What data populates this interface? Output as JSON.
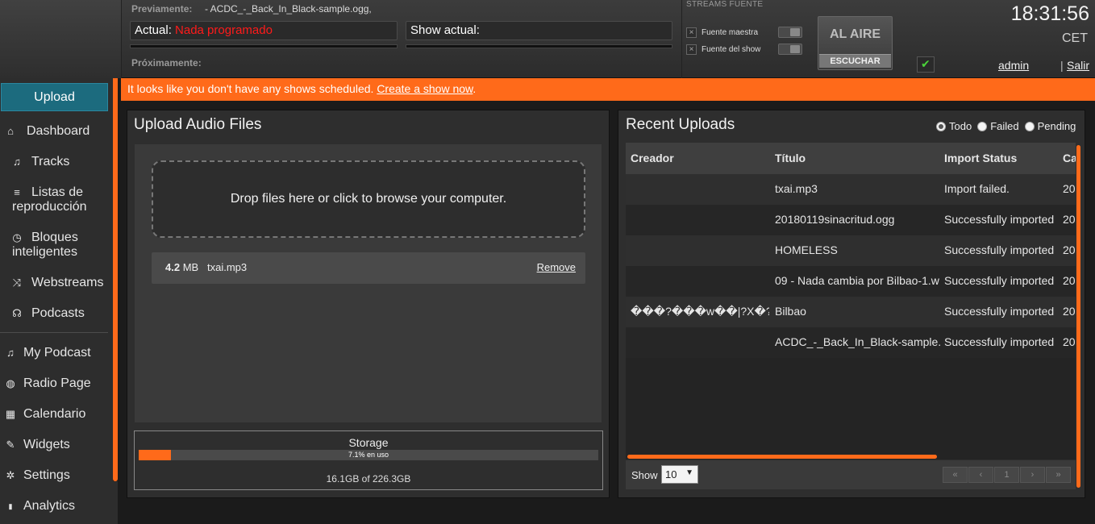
{
  "header": {
    "previously_label": "Previamente:",
    "previously_value": "- ACDC_-_Back_In_Black-sample.ogg,",
    "current_label": "Actual:",
    "current_value": "Nada programado",
    "current_show_label": "Show actual:",
    "next_label": "Próximamente:",
    "streams_title": "STREAMS FUENTE",
    "master_source": "Fuente maestra",
    "show_source": "Fuente del show",
    "x_glyph": "×",
    "on_air": "AL AIRE",
    "listen": "ESCUCHAR",
    "time": "18:31:56",
    "timezone": "CET",
    "check_glyph": "✔",
    "user": "admin",
    "separator": "|",
    "logout": "Salir"
  },
  "sidebar": {
    "upload": "Upload",
    "items": [
      {
        "label": "Dashboard",
        "icon": "⌂"
      },
      {
        "label": "Tracks",
        "icon": "♫"
      },
      {
        "label1": "Listas de",
        "label2": "reproducción",
        "icon": "≡"
      },
      {
        "label1": "Bloques",
        "label2": "inteligentes",
        "icon": "◷"
      },
      {
        "label": "Webstreams",
        "icon": "⤨"
      },
      {
        "label": "Podcasts",
        "icon": "☊"
      },
      {
        "label": "My Podcast",
        "icon": "♫"
      },
      {
        "label": "Radio Page",
        "icon": "◍"
      },
      {
        "label": "Calendario",
        "icon": "▦"
      },
      {
        "label": "Widgets",
        "icon": "✎"
      },
      {
        "label": "Settings",
        "icon": "✲"
      },
      {
        "label": "Analytics",
        "icon": "▮"
      }
    ]
  },
  "banner": {
    "text": "It looks like you don't have any shows scheduled. ",
    "link": "Create a show now",
    "period": "."
  },
  "upload_panel": {
    "title": "Upload Audio Files",
    "dropzone": "Drop files here or click to browse your computer.",
    "file": {
      "size_num": "4.2",
      "size_unit": "MB",
      "name": "txai.mp3",
      "remove": "Remove"
    },
    "storage": {
      "title": "Storage",
      "percent_text": "7.1% en uso",
      "percent": 7.1,
      "used": "16.1GB of 226.3GB"
    }
  },
  "recent_panel": {
    "title": "Recent Uploads",
    "filters": [
      {
        "label": "Todo",
        "selected": true
      },
      {
        "label": "Failed",
        "selected": false
      },
      {
        "label": "Pending",
        "selected": false
      }
    ],
    "columns": [
      "Creador",
      "Título",
      "Import Status",
      "Ca"
    ],
    "rows": [
      {
        "creator": "",
        "title": "txai.mp3",
        "status": "Import failed.",
        "date": "20"
      },
      {
        "creator": "",
        "title": "20180119sinacritud.ogg",
        "status": "Successfully imported",
        "date": "20"
      },
      {
        "creator": "",
        "title": "HOMELESS",
        "status": "Successfully imported",
        "date": "20"
      },
      {
        "creator": "",
        "title": "09 - Nada cambia por Bilbao-1.w",
        "status": "Successfully imported",
        "date": "20"
      },
      {
        "creator": "���?���w��|?X�?",
        "title": "Bilbao",
        "status": "Successfully imported",
        "date": "20"
      },
      {
        "creator": "",
        "title": "ACDC_-_Back_In_Black-sample.",
        "status": "Successfully imported",
        "date": "20"
      }
    ],
    "footer": {
      "show_label": "Show",
      "show_value": "10",
      "caret": "▼",
      "pager": [
        "«",
        "‹",
        "1",
        "›",
        "»"
      ]
    }
  }
}
